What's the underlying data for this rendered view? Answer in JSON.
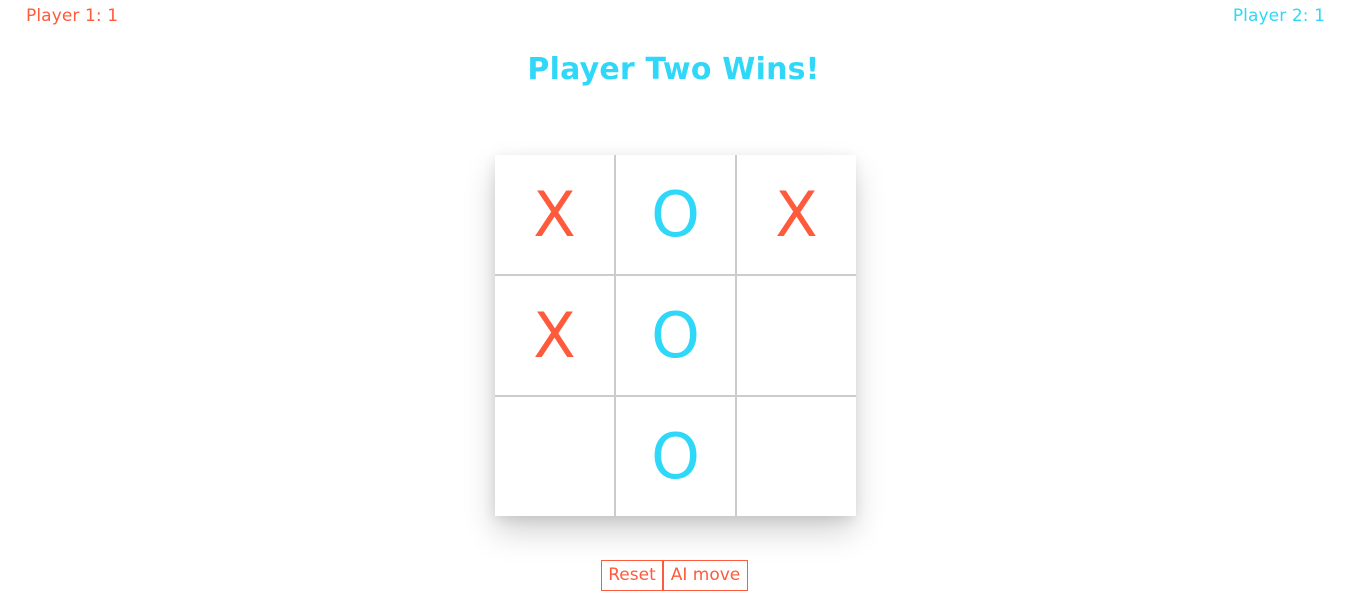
{
  "scores": {
    "player1": "Player 1: 1",
    "player2": "Player 2: 1"
  },
  "status": {
    "message": "Player Two Wins!"
  },
  "board": {
    "cells": [
      "X",
      "O",
      "X",
      "X",
      "O",
      "",
      "",
      "O",
      ""
    ]
  },
  "buttons": {
    "reset_label": "Reset",
    "ai_move_label": "AI move"
  },
  "colors": {
    "player_x": "#ff5a3c",
    "player_o": "#2fd8f8",
    "status": "#2fd8f8",
    "grid_lines": "#cccccc",
    "button_border": "#ff5a3c",
    "button_text": "#ff5a3c"
  }
}
